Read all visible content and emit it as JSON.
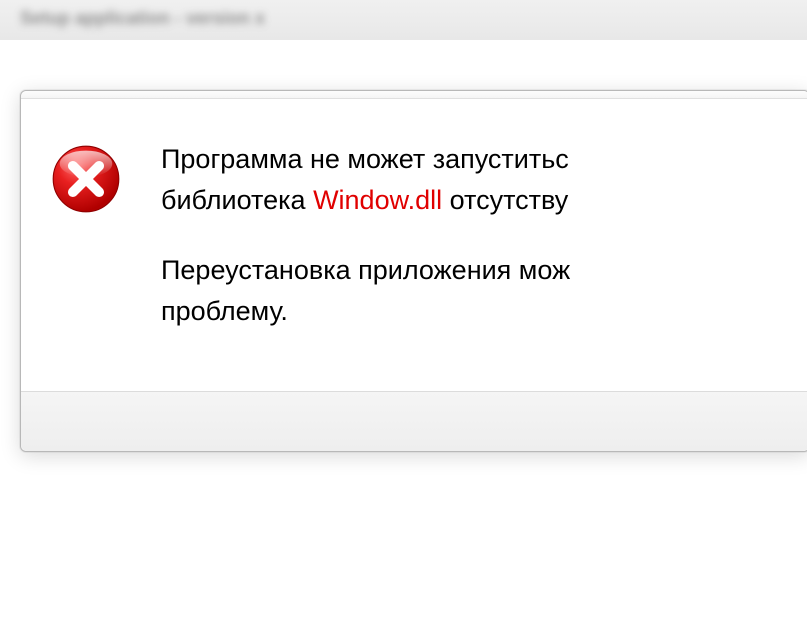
{
  "background": {
    "title": "Setup application - version x"
  },
  "dialog": {
    "icon": "error-icon",
    "message": {
      "line1_prefix": "Программа не может запуститьс",
      "line2_prefix": "библиотека ",
      "line2_highlight": "Window.dll",
      "line2_suffix": " отсутству",
      "line3": "Переустановка приложения мож",
      "line4": "проблему."
    }
  }
}
